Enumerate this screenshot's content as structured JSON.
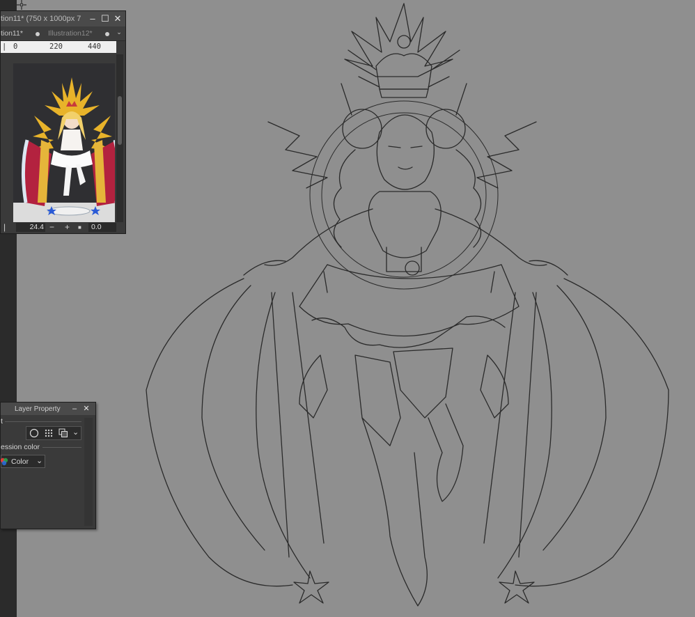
{
  "navigator": {
    "window_title": "tion11* (750 x 1000px 7",
    "tabs": [
      {
        "label": "tion11*"
      },
      {
        "label": "Illustration12*"
      }
    ],
    "ruler_labels": [
      "0",
      "220",
      "440"
    ],
    "zoom": "24.4",
    "angle": "0.0"
  },
  "layer_property": {
    "title": "Layer Property",
    "effect_label": "t",
    "expression_color_label": "ession color",
    "color_value": "Color"
  },
  "icons": [
    "minimize-icon",
    "maximize-icon",
    "close-icon",
    "chevron-down-icon",
    "zoom-out-icon",
    "zoom-in-icon",
    "stop-icon",
    "crosshair-cursor-icon",
    "border-effect-icon",
    "tone-effect-icon",
    "layer-color-icon",
    "color-wheel-icon"
  ],
  "colors": {
    "canvas": "#8f8f8f",
    "panel": "#3a3a3a",
    "sketch_line": "#2a2a2a",
    "thumbnail_gold": "#e8b32a",
    "thumbnail_red": "#b3223f"
  }
}
